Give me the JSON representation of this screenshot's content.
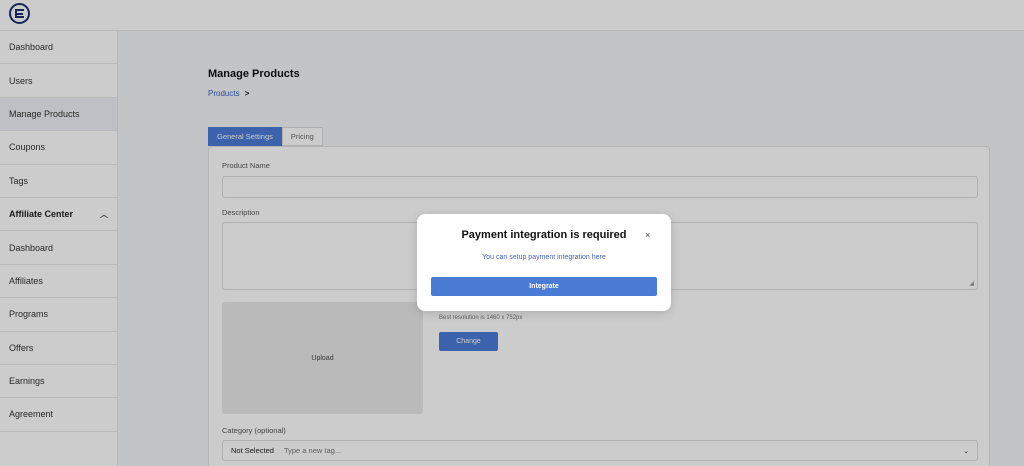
{
  "sidebar": {
    "items": [
      {
        "label": "Dashboard"
      },
      {
        "label": "Users"
      },
      {
        "label": "Manage Products"
      },
      {
        "label": "Coupons"
      },
      {
        "label": "Tags"
      },
      {
        "label": "Affiliate Center"
      },
      {
        "label": "Dashboard"
      },
      {
        "label": "Affiliates"
      },
      {
        "label": "Programs"
      },
      {
        "label": "Offers"
      },
      {
        "label": "Earnings"
      },
      {
        "label": "Agreement"
      }
    ],
    "active_item": "Manage Products",
    "section_icon": "chevron-up-icon"
  },
  "main": {
    "title": "Manage Products",
    "breadcrumb": {
      "label": "Products",
      "arrow": ">"
    },
    "tabs": [
      {
        "label": "General Settings",
        "active": true
      },
      {
        "label": "Pricing",
        "active": false
      }
    ],
    "form": {
      "product_name_label": "Product Name",
      "product_name_value": "",
      "description_label": "Description",
      "description_value": "",
      "upload_label": "Upload",
      "resolution_hint": "Best resolution is 1460 x 752px",
      "change_button": "Change",
      "category_label": "Category (optional)",
      "category_selected": "Not Selected",
      "category_placeholder": "Type a new tag..."
    }
  },
  "modal": {
    "title": "Payment integration is required",
    "close_symbol": "×",
    "subtitle": "You can setup payment integration here",
    "button_label": "Integrate"
  },
  "colors": {
    "accent": "#4a7bd5",
    "link": "#3a5fc4",
    "brand": "#1f2d6e"
  }
}
